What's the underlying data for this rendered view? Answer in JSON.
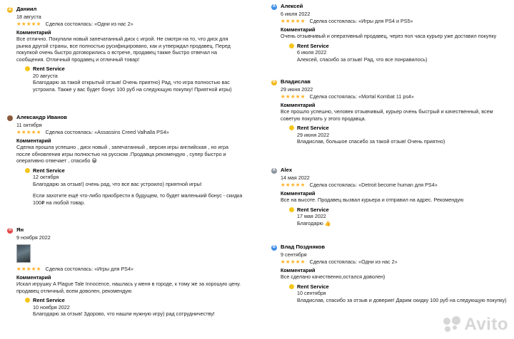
{
  "stars": "★★★★★",
  "comment_label": "Комментарий",
  "reviews": [
    {
      "avatar_letter": "Д",
      "avatar_color": "#f5b81c",
      "name": "Даниил",
      "date": "18 августа",
      "deal": "Сделка состоялась: «Одни из нас 2»",
      "comment": "Все отлично. Покупали новый запечатанный диск с игрой. Не смотря на то, что диск для рынка другой страны, все полностью русифицировано, как и утверждал продавец. Перед покупкой очень быстро договорились о встрече, продавец также быстро отвечал на сообщения. Отличный продавец и отличный товар!",
      "reply_name": "Rent Service",
      "reply_date": "20 августа",
      "reply_text": "Благодарю за такой открытый отзыв! Очень приятно) Рад, что игра полностью вас устроила. Также у вас будет бонус 100 руб на следующую покупку! Приятной игры)"
    },
    {
      "avatar_letter": "",
      "avatar_color": "#8a5a3c",
      "name": "Александр Иванов",
      "date": "11 октября",
      "deal": "Сделка состоялась: «Assassins Creed Valhalla PS4»",
      "comment": "Сделка прошла успешно , диск новый , запечатанный , версия игры английская , но игра после обновления игры полностью на русском .Продавца рекомендую , супер быстро и оперативно отвечает , спасибо 😀",
      "reply_name": "Rent Service",
      "reply_date": "12 октября",
      "reply_text": "Благодарю за отзыв!) очень рад, что все вас устроило) приятной игры!",
      "reply_text2": "Если захотите ещё что-либо приобрести в будущем, то будет маленький бонус - скидка 100₽ на любой товар."
    },
    {
      "avatar_letter": "Я",
      "avatar_color": "#e04848",
      "name": "Ян",
      "date": "9 ноября 2022",
      "deal": "Сделка состоялась: «Игры для PS4»",
      "comment": "Искал игрушку A Plague Tale Innocence, нашлась у меня в городе, к тому же за хорошую цену. продавец отличный, всем доволен, рекомендую",
      "reply_name": "Rent Service",
      "reply_date": "10 ноября 2022",
      "reply_text": "Благодарю за отзыв! Здорово, что нашли нужную игру) рад сотрудничеству!"
    },
    {
      "avatar_letter": "А",
      "avatar_color": "#3f8ee8",
      "name": "Алексей",
      "date": "6 июля 2022",
      "deal": "Сделка состоялась: «Игры для PS4 и PS5»",
      "comment": "Очень отзывчивый и оперативный продавец, через пол часа курьер уже доставил покупку",
      "reply_name": "Rent Service",
      "reply_date": "6 июля 2022",
      "reply_text": "Алексей, спасибо за отзыв! Рад, что все понравилось)"
    },
    {
      "avatar_letter": "В",
      "avatar_color": "#f5b81c",
      "name": "Владислав",
      "date": "29 июня 2022",
      "deal": "Сделка состоялась: «Mortal Kombat 11 ps4»",
      "comment": "Все прошло успешно, человек отзывчивый, курьер очень быстрый и качественный, всем советую покупать у этого продавца.",
      "reply_name": "Rent Service",
      "reply_date": "29 июня 2022",
      "reply_text": "Владислав, большое спасибо за такой отзыв! Очень приятно)"
    },
    {
      "avatar_letter": "A",
      "avatar_color": "#8a94a0",
      "name": "Alex",
      "date": "14 мая 2022",
      "deal": "Сделка состоялась: «Detroit become human для PS4»",
      "comment": "Все на высоте. Продавец вызвал курьера и отправил на адрес. Рекомендую",
      "reply_name": "Rent Service",
      "reply_date": "17 мая 2022",
      "reply_text": "Благодарю 👍"
    },
    {
      "avatar_letter": "В",
      "avatar_color": "#3f8ee8",
      "name": "Влад Поздняков",
      "date": "9 сентября",
      "deal": "Сделка состоялась: «Одни из нас 2»",
      "comment": "Все сделано качественно,остался доволен)",
      "reply_name": "Rent Service",
      "reply_date": "10 сентября",
      "reply_text": "Владислав, спасибо за отзыв и доверие! Дарим скидку 100 руб на следующую покупку)"
    }
  ],
  "watermark_text": "Avito"
}
